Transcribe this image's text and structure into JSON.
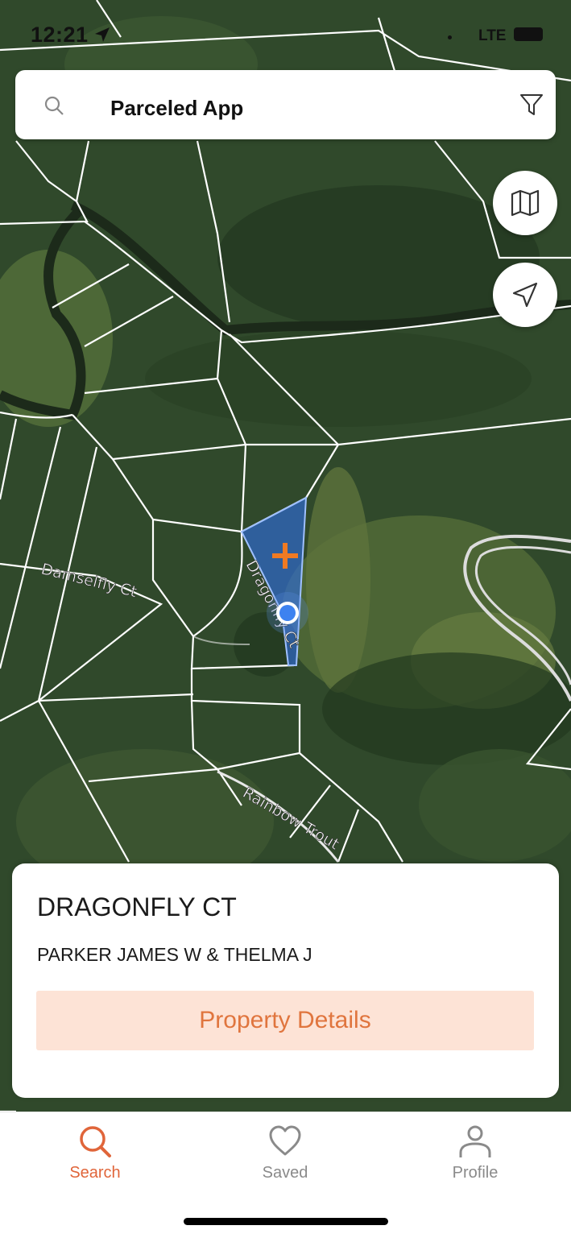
{
  "status": {
    "time": "12:21",
    "network": "LTE"
  },
  "search": {
    "title": "Parceled App"
  },
  "map": {
    "road_labels": [
      "Damselfly Ct",
      "Dragonfly Ct",
      "Rainbow Trout"
    ],
    "selection_color": "#2f6bd8",
    "marker_color": "#f07a22"
  },
  "card": {
    "address": "DRAGONFLY CT",
    "owner": "PARKER JAMES W & THELMA J",
    "details_label": "Property Details"
  },
  "tabs": [
    {
      "label": "Search",
      "icon": "search-icon",
      "active": true
    },
    {
      "label": "Saved",
      "icon": "heart-icon",
      "active": false
    },
    {
      "label": "Profile",
      "icon": "person-icon",
      "active": false
    }
  ],
  "colors": {
    "accent": "#e0653a",
    "details_bg": "#fde3d6"
  }
}
